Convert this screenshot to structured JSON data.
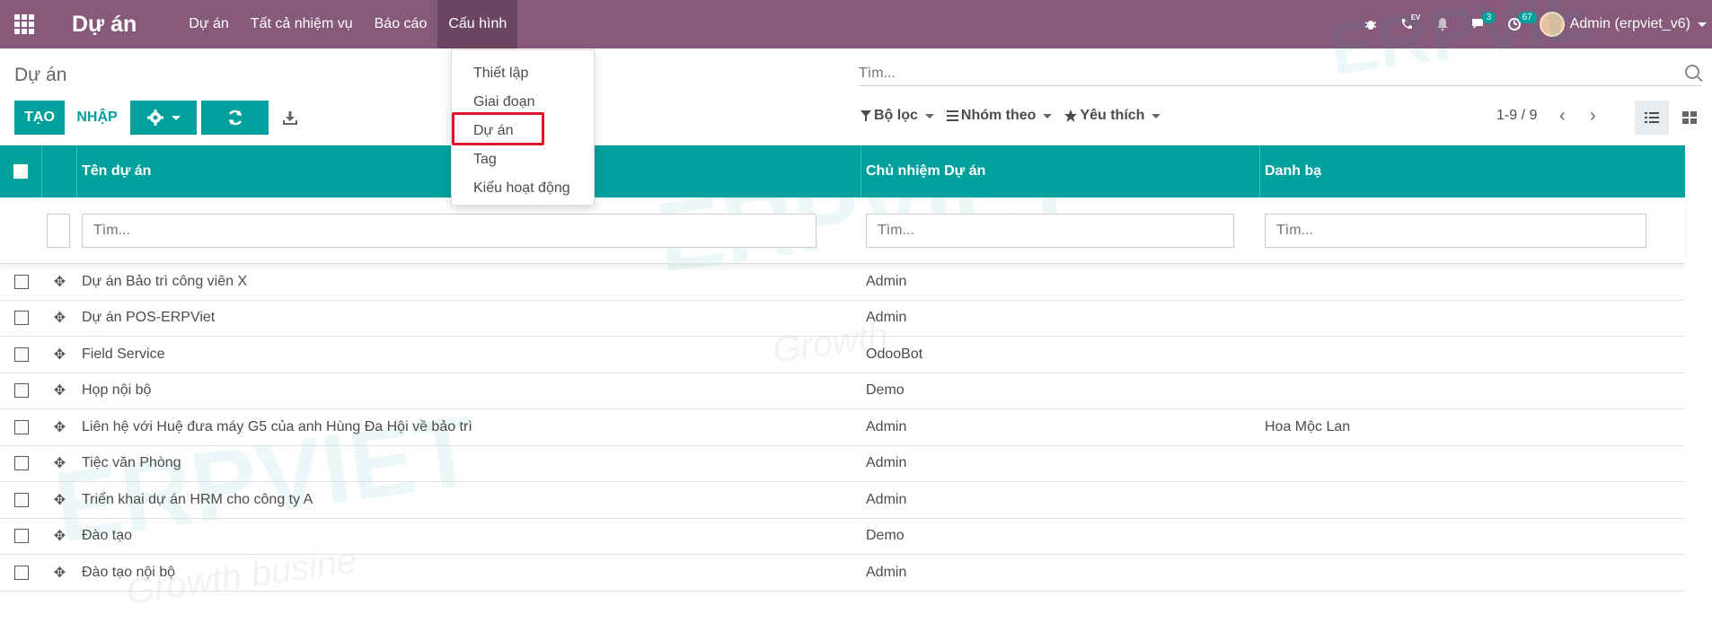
{
  "navbar": {
    "brand": "Dự án",
    "menu": [
      {
        "label": "Dự án"
      },
      {
        "label": "Tất cả nhiệm vụ"
      },
      {
        "label": "Báo cáo"
      },
      {
        "label": "Cấu hình"
      }
    ],
    "ev_label": "EV",
    "chat_count": "3",
    "activity_count": "67",
    "user_name": "Admin (erpviet_v6)"
  },
  "control_panel": {
    "breadcrumb": "Dự án",
    "search_placeholder": "Tìm...",
    "create_label": "TẠO",
    "import_label": "NHẬP",
    "filters": [
      {
        "label": "Bộ lọc"
      },
      {
        "label": "Nhóm theo"
      },
      {
        "label": "Yêu thích"
      }
    ],
    "pager": "1-9 / 9"
  },
  "dropdown": {
    "items": [
      {
        "label": "Thiết lập"
      },
      {
        "label": "Giai đoạn"
      },
      {
        "label": "Dự án"
      },
      {
        "label": "Tag"
      },
      {
        "label": "Kiểu hoạt động"
      }
    ]
  },
  "table": {
    "columns": {
      "name": "Tên dự án",
      "manager": "Chủ nhiệm Dự án",
      "contact": "Danh bạ"
    },
    "filter_placeholder": "Tìm...",
    "rows": [
      {
        "name": "Dự án Bảo trì công viên X",
        "manager": "Admin",
        "contact": ""
      },
      {
        "name": "Dự án POS-ERPViet",
        "manager": "Admin",
        "contact": ""
      },
      {
        "name": "Field Service",
        "manager": "OdooBot",
        "contact": ""
      },
      {
        "name": "Họp nội bộ",
        "manager": "Demo",
        "contact": ""
      },
      {
        "name": "Liên hệ với Huệ đưa máy G5 của anh Hùng Đa Hội về bảo trì",
        "manager": "Admin",
        "contact": "Hoa Mộc Lan"
      },
      {
        "name": "Tiệc văn Phòng",
        "manager": "Admin",
        "contact": ""
      },
      {
        "name": "Triển khai dự án HRM cho công ty A",
        "manager": "Admin",
        "contact": ""
      },
      {
        "name": "Đào tạo",
        "manager": "Demo",
        "contact": ""
      },
      {
        "name": "Đào tạo nội bộ",
        "manager": "Admin",
        "contact": ""
      }
    ]
  },
  "colors": {
    "navbar": "#875a7b",
    "accent": "#00a09d",
    "highlight": "#e0162b"
  }
}
